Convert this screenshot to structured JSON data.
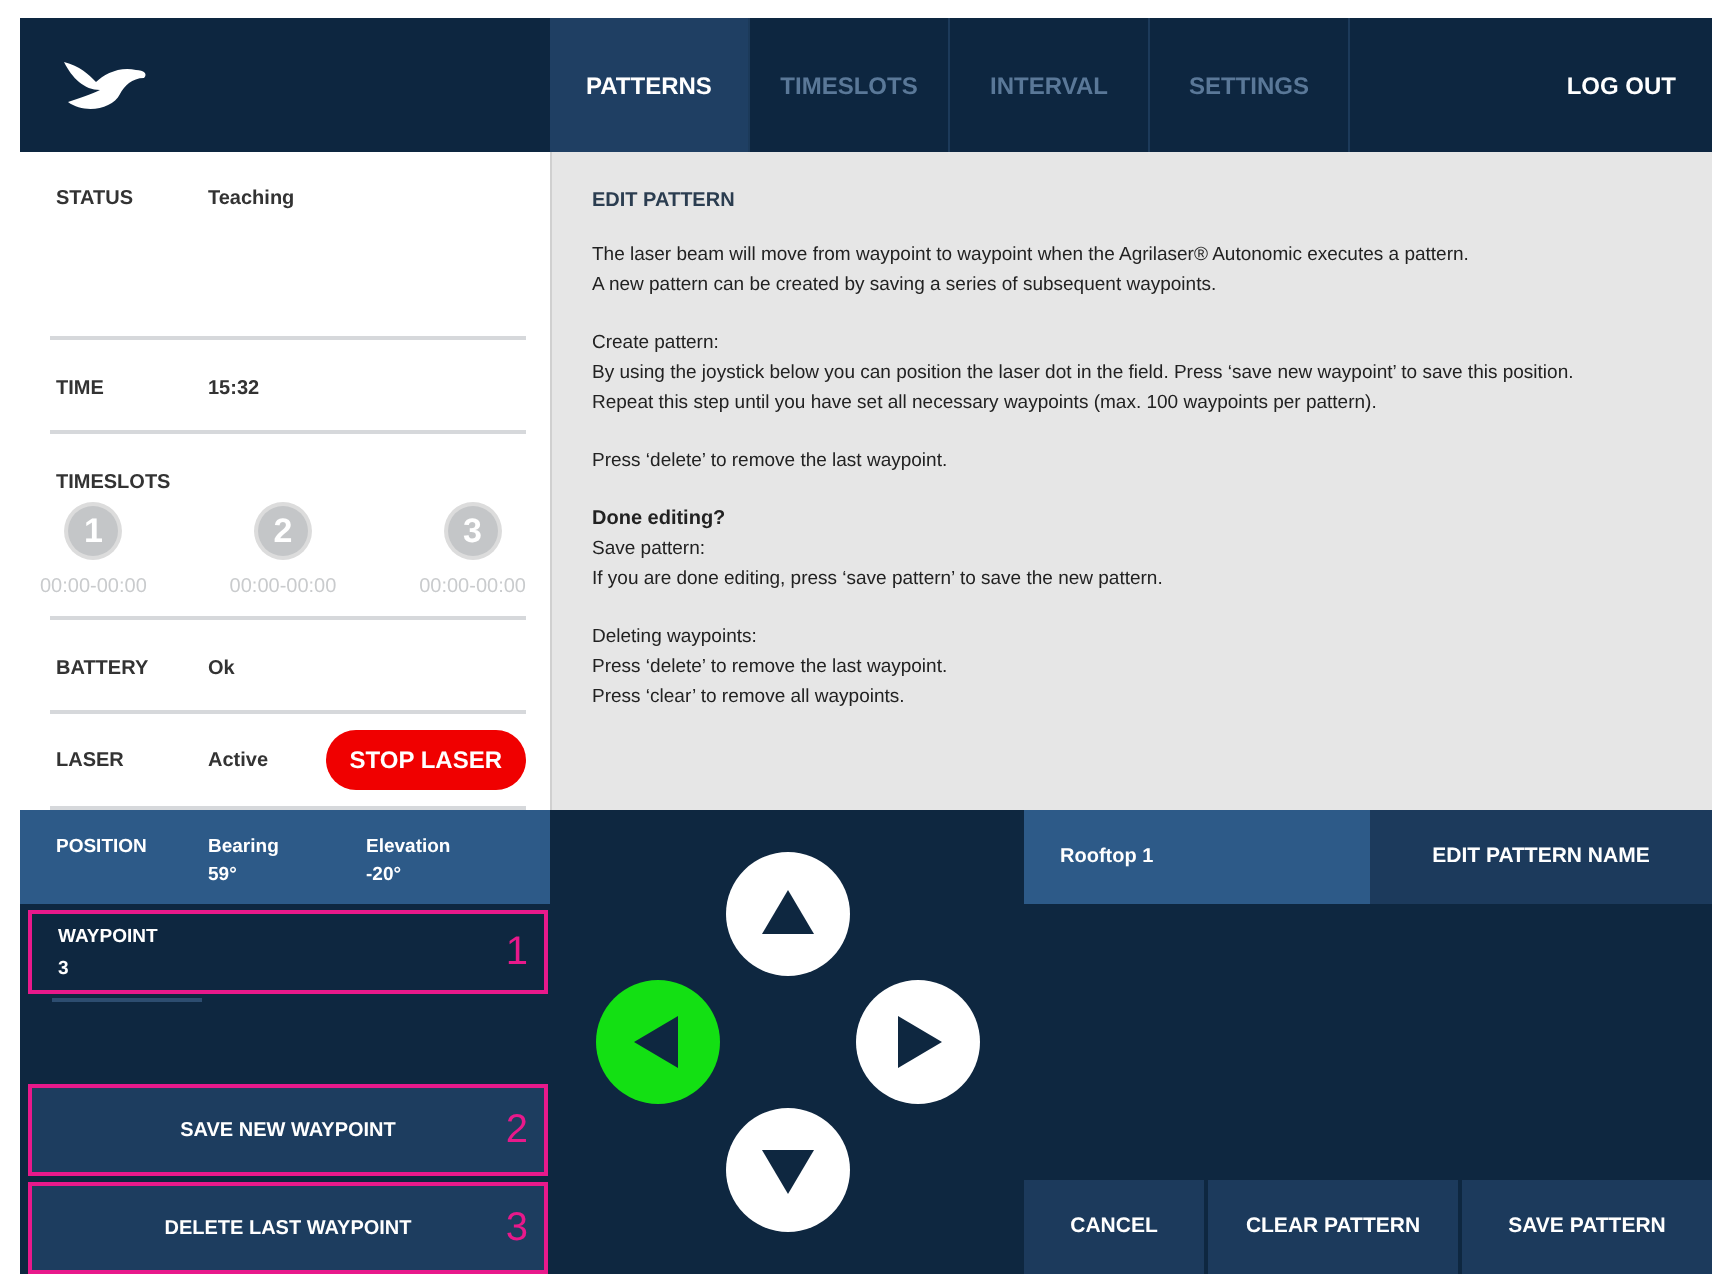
{
  "header": {
    "tabs": [
      {
        "label": "PATTERNS",
        "selected": true,
        "disabled": false
      },
      {
        "label": "TIMESLOTS",
        "selected": false,
        "disabled": true
      },
      {
        "label": "INTERVAL",
        "selected": false,
        "disabled": true
      },
      {
        "label": "SETTINGS",
        "selected": false,
        "disabled": true
      }
    ],
    "logout": "LOG OUT"
  },
  "status_panel": {
    "status": {
      "label": "STATUS",
      "value": "Teaching"
    },
    "time": {
      "label": "TIME",
      "value": "15:32"
    },
    "timeslots": {
      "label": "TIMESLOTS",
      "slots": [
        {
          "number": "1",
          "range": "00:00-00:00",
          "active": false
        },
        {
          "number": "2",
          "range": "00:00-00:00",
          "active": false
        },
        {
          "number": "3",
          "range": "00:00-00:00",
          "active": false
        }
      ]
    },
    "battery": {
      "label": "BATTERY",
      "value": "Ok"
    },
    "laser": {
      "label": "LASER",
      "value": "Active",
      "button": "STOP LASER"
    }
  },
  "content": {
    "title": "EDIT PATTERN",
    "paragraphs": [
      {
        "lines": [
          "The laser beam will move from waypoint to waypoint when the Agrilaser® Autonomic executes a pattern.",
          "A new pattern can be created by saving a series of subsequent waypoints."
        ]
      },
      {
        "lines": [
          "Create pattern:",
          "By using the joystick below you can position the laser dot in the field. Press ‘save new waypoint’ to save this position.",
          "Repeat this step until you have set all necessary waypoints (max. 100 waypoints per pattern)."
        ]
      },
      {
        "lines": [
          "Press ‘delete’ to remove the last waypoint."
        ]
      },
      {
        "heading": "Done editing?",
        "lines": [
          "Save pattern:",
          "If you are done editing, press ‘save pattern’ to save the new pattern."
        ]
      },
      {
        "lines": [
          "Deleting waypoints:",
          "Press ‘delete’ to remove the last waypoint.",
          "Press ‘clear’ to remove all waypoints."
        ]
      }
    ]
  },
  "position": {
    "label": "POSITION",
    "readings": [
      {
        "label": "Bearing",
        "value": "59°"
      },
      {
        "label": "Elevation",
        "value": "-20°"
      }
    ]
  },
  "waypoint": {
    "label": "WAYPOINT",
    "value": "3",
    "annotation": "1"
  },
  "waypoint_buttons": [
    {
      "label": "SAVE NEW WAYPOINT",
      "annotation": "2"
    },
    {
      "label": "DELETE LAST WAYPOINT",
      "annotation": "3"
    }
  ],
  "joystick": [
    {
      "kind": "up",
      "active": false
    },
    {
      "kind": "left",
      "active": true
    },
    {
      "kind": "right",
      "active": false
    },
    {
      "kind": "down",
      "active": false
    }
  ],
  "pattern": {
    "name": "Rooftop 1",
    "edit_button": "EDIT PATTERN NAME"
  },
  "pattern_buttons": [
    "CANCEL",
    "CLEAR PATTERN",
    "SAVE PATTERN"
  ]
}
